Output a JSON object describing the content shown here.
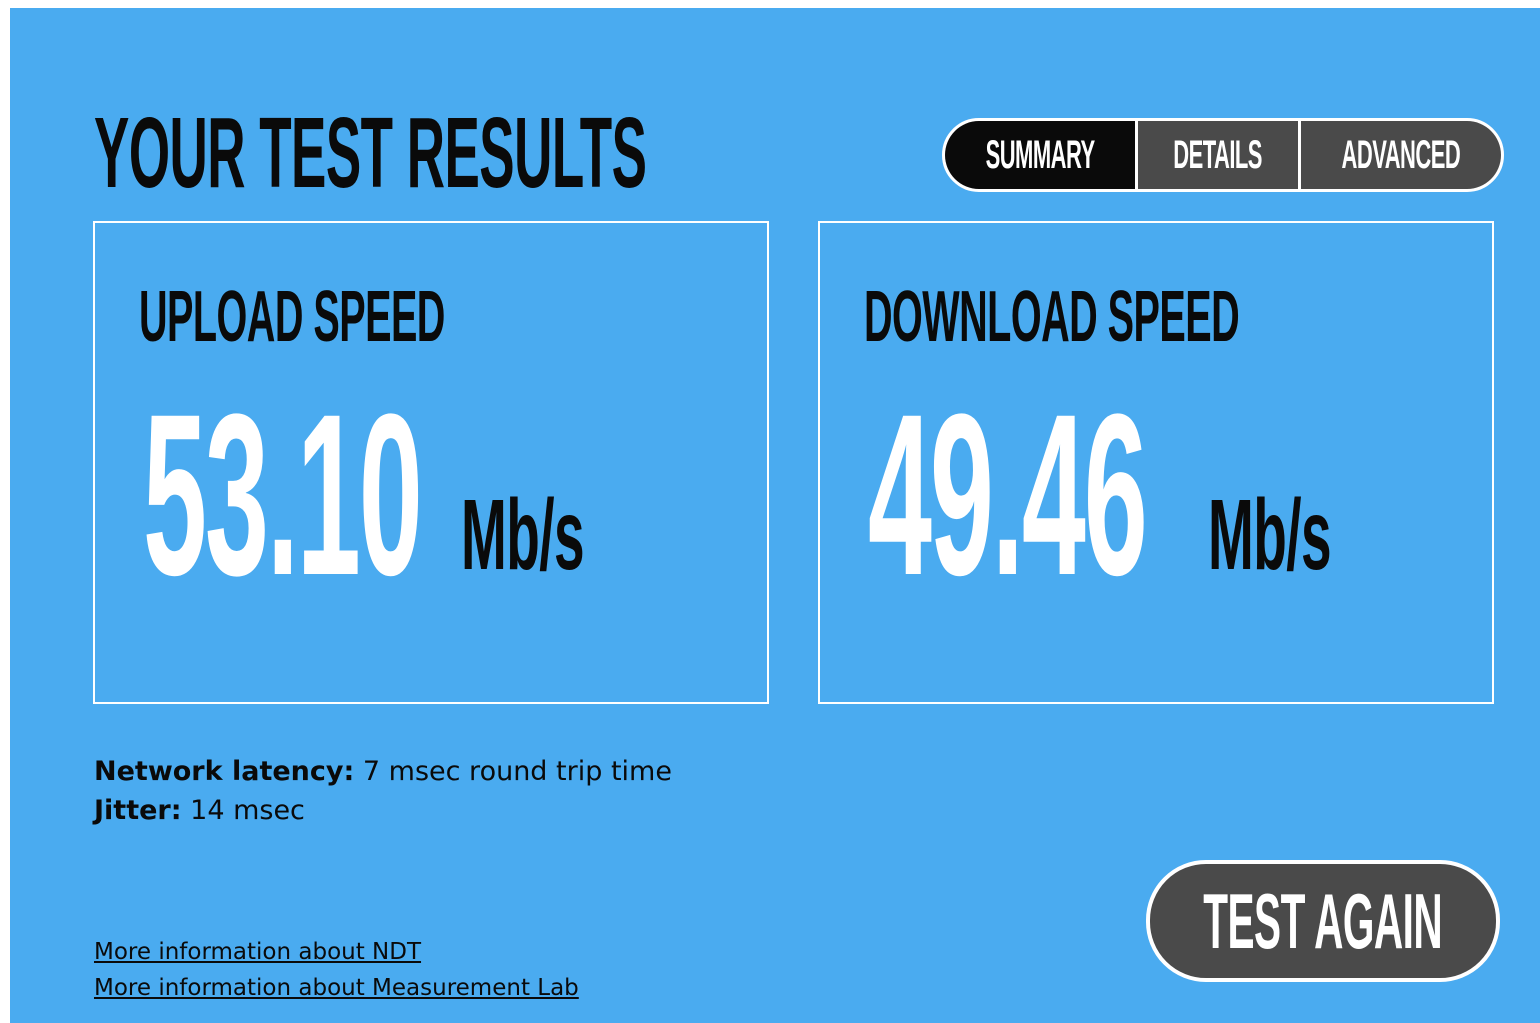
{
  "page": {
    "title": "YOUR TEST RESULTS"
  },
  "tabs": [
    {
      "label": "SUMMARY",
      "active": true
    },
    {
      "label": "DETAILS",
      "active": false
    },
    {
      "label": "ADVANCED",
      "active": false
    }
  ],
  "upload": {
    "title": "UPLOAD SPEED",
    "value": "53.10",
    "unit": "Mb/s"
  },
  "download": {
    "title": "DOWNLOAD SPEED",
    "value": "49.46",
    "unit": "Mb/s"
  },
  "stats": {
    "latency_label": "Network latency:",
    "latency_value": "7 msec round trip time",
    "jitter_label": "Jitter:",
    "jitter_value": "14 msec"
  },
  "links": {
    "ndt": "More information about NDT",
    "mlab": "More information about Measurement Lab"
  },
  "actions": {
    "test_again": "TEST AGAIN"
  },
  "colors": {
    "background": "#4aabf0",
    "active_tab": "#0a0a0a",
    "inactive_tab": "#4a4a4a",
    "value_text": "#ffffff"
  }
}
